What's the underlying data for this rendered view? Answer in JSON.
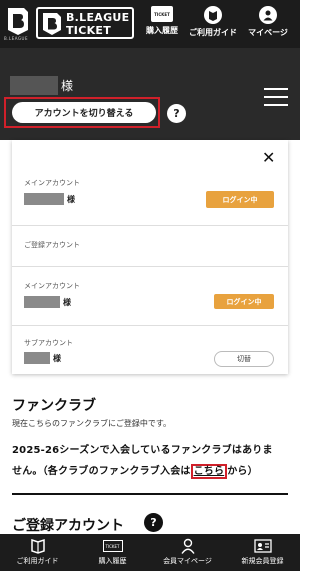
{
  "header": {
    "logo_sub": "B.LEAGUE",
    "ticket_logo_line1": "B.LEAGUE",
    "ticket_logo_line2": "TICKET",
    "nav": [
      {
        "label": "購入履歴",
        "icon": "ticket-icon"
      },
      {
        "label": "ご利用ガイド",
        "icon": "guide-icon"
      },
      {
        "label": "マイページ",
        "icon": "user-icon"
      }
    ],
    "ticket_icon_text": "TICKET"
  },
  "account": {
    "honorific": "様",
    "switch_label": "アカウントを切り替える",
    "help": "?"
  },
  "panel": {
    "close": "✕",
    "main_label": "メインアカウント",
    "honorific": "様",
    "login_status": "ログイン中",
    "registered_label": "ご登録アカウント",
    "sub_label": "サブアカウント",
    "switch_button": "切替"
  },
  "fanclub": {
    "title": "ファンクラブ",
    "line1": "現在こちらのファンクラブにご登録中です。",
    "line2": "2025-26シーズンで入会しているファンクラブはありま",
    "line3_pre": "せん。（各クラブのファンクラブ入会は",
    "line3_link": "こちら",
    "line3_post": "から）"
  },
  "registered": {
    "title": "ご登録アカウント",
    "help": "?"
  },
  "bottom_nav": [
    {
      "label": "ご利用ガイド",
      "icon": "guide-icon"
    },
    {
      "label": "購入履歴",
      "icon": "ticket-icon"
    },
    {
      "label": "会員マイページ",
      "icon": "user-icon"
    },
    {
      "label": "新規会員登録",
      "icon": "id-card-icon"
    }
  ],
  "colors": {
    "header_bg": "#1c1c1c",
    "band_bg": "#2a2a2a",
    "login_badge": "#e8a23e",
    "highlight_red": "#d0202a"
  }
}
